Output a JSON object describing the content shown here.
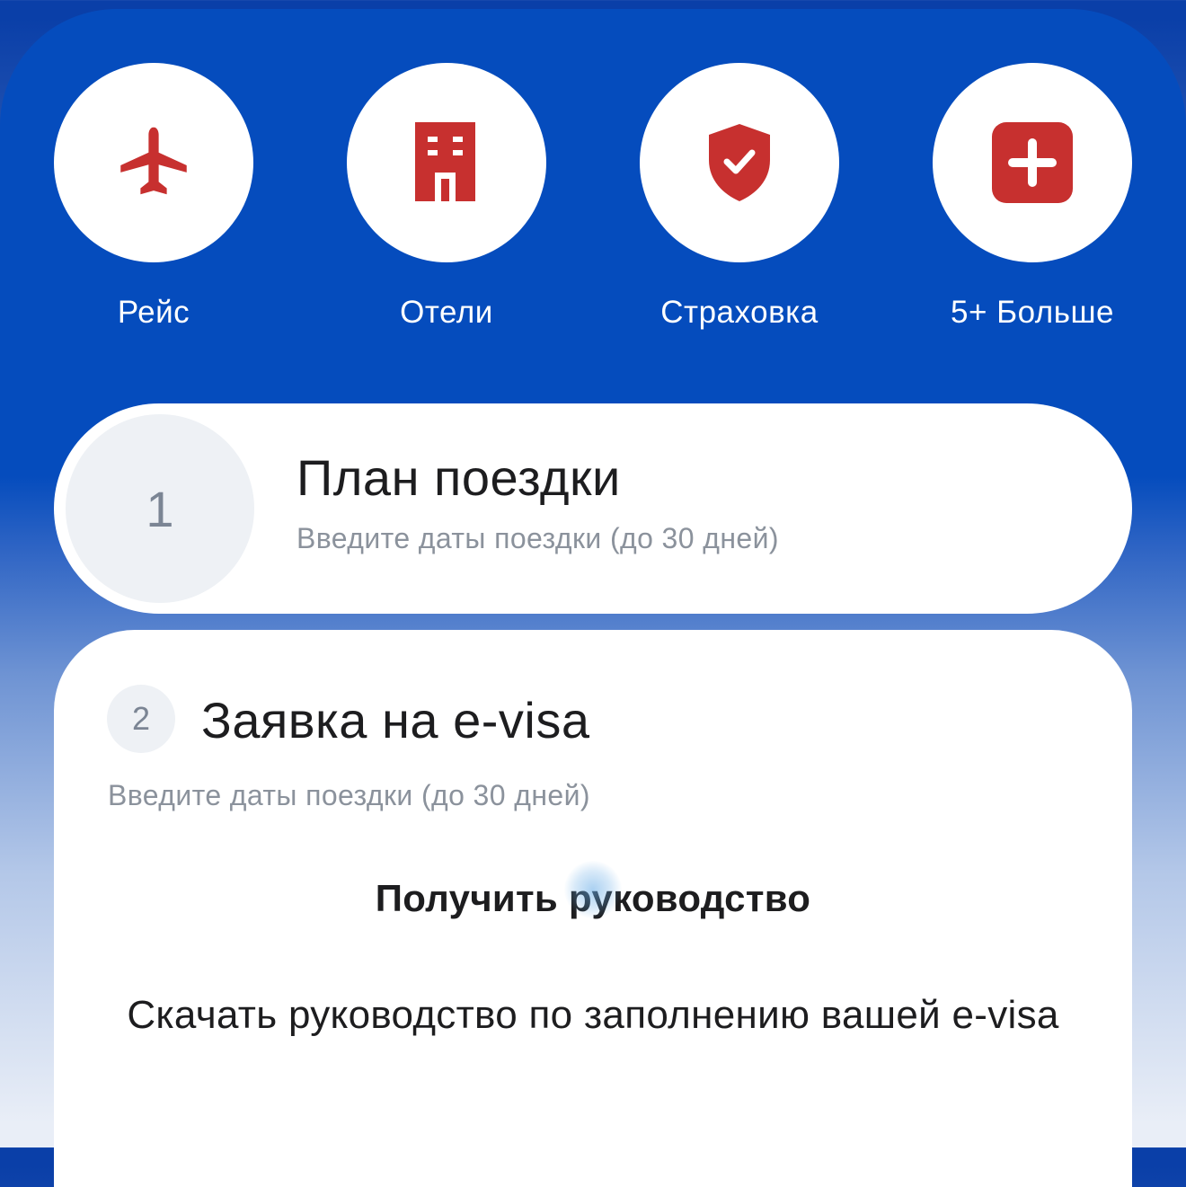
{
  "quick_actions": [
    {
      "label": "Рейс",
      "icon": "airplane-icon"
    },
    {
      "label": "Отели",
      "icon": "hotel-building-icon"
    },
    {
      "label": "Страховка",
      "icon": "shield-check-icon"
    },
    {
      "label": "5+ Больше",
      "icon": "plus-square-icon"
    }
  ],
  "step1": {
    "number": "1",
    "title": "План поездки",
    "subtitle": "Введите даты поездки (до 30 дней)"
  },
  "step2": {
    "number": "2",
    "title": "Заявка на e-visa",
    "subtitle": "Введите даты поездки (до 30 дней)",
    "guide_button": "Получить руководство",
    "guide_description": "Скачать руководство по заполнению вашей e-visa"
  },
  "colors": {
    "brand_blue": "#054cbd",
    "icon_red": "#c7302f",
    "text_dark": "#1d1d1f",
    "text_muted": "#8b929c"
  }
}
